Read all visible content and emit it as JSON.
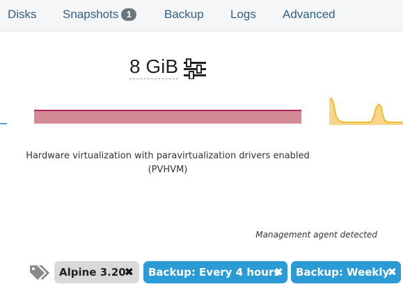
{
  "tabs": {
    "disks": "Disks",
    "snapshots": "Snapshots",
    "snapshots_count": "1",
    "backup": "Backup",
    "logs": "Logs",
    "advanced": "Advanced"
  },
  "memory": {
    "value": "8 GiB",
    "icon": "sliders-icon"
  },
  "virtualization": {
    "mode_text": "Hardware virtualization with paravirtualization drivers enabled (PVHVM)"
  },
  "agent": {
    "status_text": "Management agent detected"
  },
  "tags": {
    "icon": "tags-icon",
    "items": [
      {
        "label": "Alpine 3.20",
        "remove": "✖"
      },
      {
        "label": "Backup: Every 4 hours",
        "remove": "✖"
      },
      {
        "label": "Backup: Weekly",
        "remove": "✖"
      }
    ]
  },
  "colors": {
    "tab_text": "#2f5f86",
    "bar_fill": "#d48b96",
    "bar_line": "#b0255b",
    "sparkline_fill": "#f8d58a",
    "sparkline_line": "#e8c02e",
    "tag_gray": "#d9d9d9",
    "tag_blue": "#2b9bd6"
  }
}
